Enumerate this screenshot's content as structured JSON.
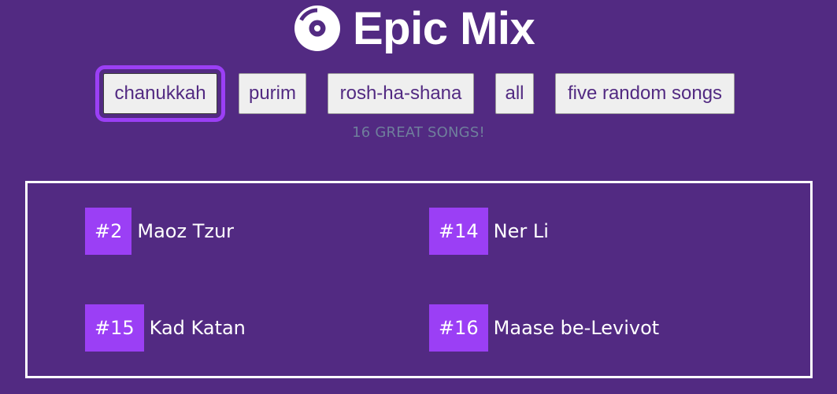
{
  "header": {
    "logo_icon": "vinyl-disc-icon",
    "title": "Epic Mix"
  },
  "filters": [
    {
      "label": "chanukkah",
      "active": true
    },
    {
      "label": "purim",
      "active": false
    },
    {
      "label": "rosh-ha-shana",
      "active": false
    },
    {
      "label": "all",
      "active": false
    },
    {
      "label": "five random songs",
      "active": false
    }
  ],
  "song_count": "16 GREAT SONGS!",
  "songs": [
    {
      "number": "#2",
      "name": "Maoz Tzur"
    },
    {
      "number": "#14",
      "name": "Ner Li"
    },
    {
      "number": "#15",
      "name": "Kad Katan"
    },
    {
      "number": "#16",
      "name": "Maase be-Levivot"
    }
  ],
  "colors": {
    "background": "#522a82",
    "accent": "#9b3ff5",
    "count_text": "#6f7f9c"
  }
}
